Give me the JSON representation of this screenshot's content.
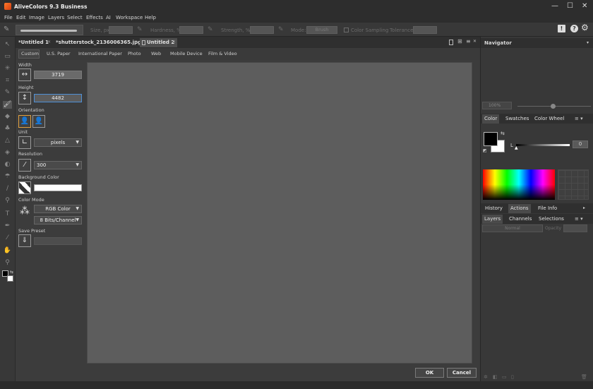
{
  "app": {
    "title": "AliveColors 9.3 Business"
  },
  "window_controls": {
    "minimize": "—",
    "maximize": "☐",
    "close": "✕"
  },
  "menu": [
    "File",
    "Edit",
    "Image",
    "Layers",
    "Select",
    "Effects",
    "AI",
    "Workspace",
    "Help"
  ],
  "options_bar": {
    "size_label": "Size, px",
    "hardness_label": "Hardness, %",
    "strength_label": "Strength, %",
    "mode_label": "Mode:",
    "mode_value": "Brush",
    "color_sampling_label": "Color Sampling",
    "tolerance_label": "Tolerance"
  },
  "doc_tabs": [
    {
      "label": "*Untitled 1"
    },
    {
      "label": "*shutterstock_2136006365.jpg"
    },
    {
      "label": "Untitled 2"
    }
  ],
  "preset_tabs": [
    "Custom",
    "U.S. Paper",
    "International Paper",
    "Photo",
    "Web",
    "Mobile Device",
    "Film & Video"
  ],
  "new_image": {
    "width_label": "Width",
    "width_value": "3719",
    "height_label": "Height",
    "height_value": "4482",
    "orientation_label": "Orientation",
    "unit_label": "Unit",
    "unit_value": "pixels",
    "resolution_label": "Resolution",
    "resolution_value": "300",
    "background_label": "Background Color",
    "background_color": "#ffffff",
    "color_mode_label": "Color Mode",
    "color_mode_value": "RGB Color",
    "bit_depth_value": "8 Bits/Channel",
    "save_preset_label": "Save Preset"
  },
  "buttons": {
    "ok": "OK",
    "cancel": "Cancel"
  },
  "navigator": {
    "title": "Navigator",
    "zoom": "100%"
  },
  "color_panel": {
    "tabs": [
      "Color",
      "Swatches",
      "Color Wheel"
    ],
    "channel_label": "L",
    "channel_value": "0",
    "foreground": "#000000",
    "background": "#ffffff"
  },
  "history_tabs": [
    "History",
    "Actions",
    "File Info"
  ],
  "layers_panel": {
    "tabs": [
      "Layers",
      "Channels",
      "Selections"
    ],
    "blend_mode": "Normal",
    "opacity_label": "Opacity"
  },
  "colors": {
    "accent": "#4e90d6",
    "panel": "#383838",
    "canvas": "#5d5d5d"
  }
}
